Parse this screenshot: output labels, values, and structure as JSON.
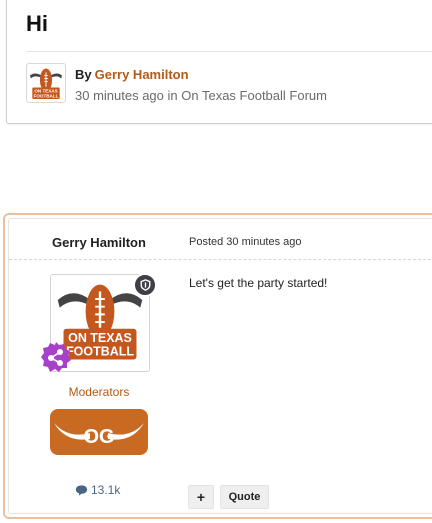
{
  "topic": {
    "title": "Hi",
    "byline_prefix": "By",
    "author": "Gerry Hamilton",
    "meta_time": "30 minutes ago in",
    "forum": "On Texas Football Forum"
  },
  "post": {
    "author": "Gerry Hamilton",
    "posted": "Posted 30 minutes ago",
    "group": "Moderators",
    "reputation": "13.1k",
    "body": "Let's get the party started!",
    "plus_label": "+",
    "quote_label": "Quote"
  },
  "logo": {
    "line1": "ON TEXAS",
    "line2": "FOOTBALL",
    "og_text": "OG"
  },
  "colors": {
    "accent": "#b35b17",
    "card_highlight": "#ecc09c",
    "og_badge": "#c96a22",
    "rank_badge": "#a642c9",
    "mod_badge": "#3f3f46",
    "reputation": "#4a6484"
  },
  "icons": {
    "mod": "shield-icon",
    "rank": "share-network-icon",
    "reputation": "speech-bubble-icon"
  }
}
